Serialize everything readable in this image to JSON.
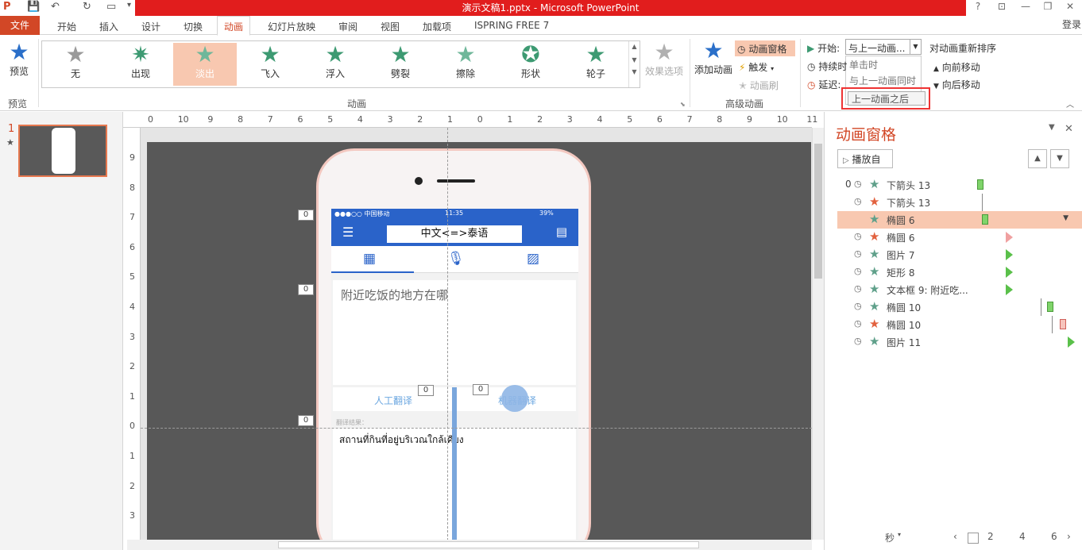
{
  "window": {
    "title": "演示文稿1.pptx -  Microsoft PowerPoint",
    "help": "?",
    "login": "登录"
  },
  "tabs": [
    "文件",
    "开始",
    "插入",
    "设计",
    "切换",
    "动画",
    "幻灯片放映",
    "审阅",
    "视图",
    "加载项",
    "ISPRING FREE 7"
  ],
  "ribbon": {
    "preview_label": "预览",
    "preview_group": "预览",
    "gallery_items": [
      "无",
      "出现",
      "淡出",
      "飞入",
      "浮入",
      "劈裂",
      "擦除",
      "形状",
      "轮子"
    ],
    "gallery_selected": "淡出",
    "effect_options": "效果选项",
    "animation_group": "动画",
    "add_animation": "添加动画",
    "animation_pane": "动画窗格",
    "trigger": "触发",
    "animation_painter": "动画刷",
    "advanced_group": "高级动画",
    "start_label": "开始:",
    "start_value": "与上一动画...",
    "duration_label": "持续时",
    "delay_label": "延迟:",
    "start_options": [
      "单击时",
      "与上一动画同时",
      "上一动画之后"
    ],
    "reorder_title": "对动画重新排序",
    "move_earlier": "向前移动",
    "move_later": "向后移动"
  },
  "thumbs": {
    "slide_number": "1",
    "anim_marker": "★"
  },
  "hruler": [
    "0",
    "10",
    "9",
    "8",
    "7",
    "6",
    "5",
    "4",
    "3",
    "2",
    "1",
    "0",
    "1",
    "2",
    "3",
    "4",
    "5",
    "6",
    "7",
    "8",
    "9",
    "10",
    "11",
    "12"
  ],
  "vruler": [
    "9",
    "8",
    "7",
    "6",
    "5",
    "4",
    "3",
    "2",
    "1",
    "0",
    "1",
    "2",
    "3"
  ],
  "slide": {
    "status_left": "●●●○○ 中国移动",
    "status_time": "11:35",
    "status_right": "39%",
    "app_title": "中文<=>泰语",
    "input_text": "附近吃饭的地方在哪",
    "human_translate": "人工翻译",
    "machine_translate": "机器翻译",
    "result_label": "翻译结果：",
    "result_text": "สถานที่กินที่อยู่บริเวณใกล้เคียง",
    "tags": [
      "0",
      "0",
      "0",
      "0",
      "0"
    ]
  },
  "anipane": {
    "title": "动画窗格",
    "play_from": "播放自",
    "rows": [
      {
        "n": "0",
        "clock": "◷",
        "name": "下箭头 13",
        "color": "#5fa08a",
        "kind": "bar-green"
      },
      {
        "n": "",
        "clock": "◷",
        "name": "下箭头 13",
        "color": "#e2613e",
        "kind": "line"
      },
      {
        "n": "",
        "clock": "",
        "name": "椭圆 6",
        "color": "#5fa08a",
        "kind": "bar-green",
        "selected": true
      },
      {
        "n": "",
        "clock": "◷",
        "name": "椭圆 6",
        "color": "#e2613e",
        "kind": "tri-red"
      },
      {
        "n": "",
        "clock": "◷",
        "name": "图片 7",
        "color": "#5fa08a",
        "kind": "tri-green"
      },
      {
        "n": "",
        "clock": "◷",
        "name": "矩形 8",
        "color": "#5fa08a",
        "kind": "tri-green"
      },
      {
        "n": "",
        "clock": "◷",
        "name": "文本框 9: 附近吃...",
        "color": "#5fa08a",
        "kind": "tri-green"
      },
      {
        "n": "",
        "clock": "◷",
        "name": "椭圆 10",
        "color": "#5fa08a",
        "kind": "bar-green"
      },
      {
        "n": "",
        "clock": "◷",
        "name": "椭圆 10",
        "color": "#e2613e",
        "kind": "bar-red"
      },
      {
        "n": "",
        "clock": "◷",
        "name": "图片 11",
        "color": "#5fa08a",
        "kind": "tri-green"
      }
    ],
    "footer_unit": "秒",
    "footer_ticks": [
      "2",
      "4",
      "6"
    ]
  }
}
